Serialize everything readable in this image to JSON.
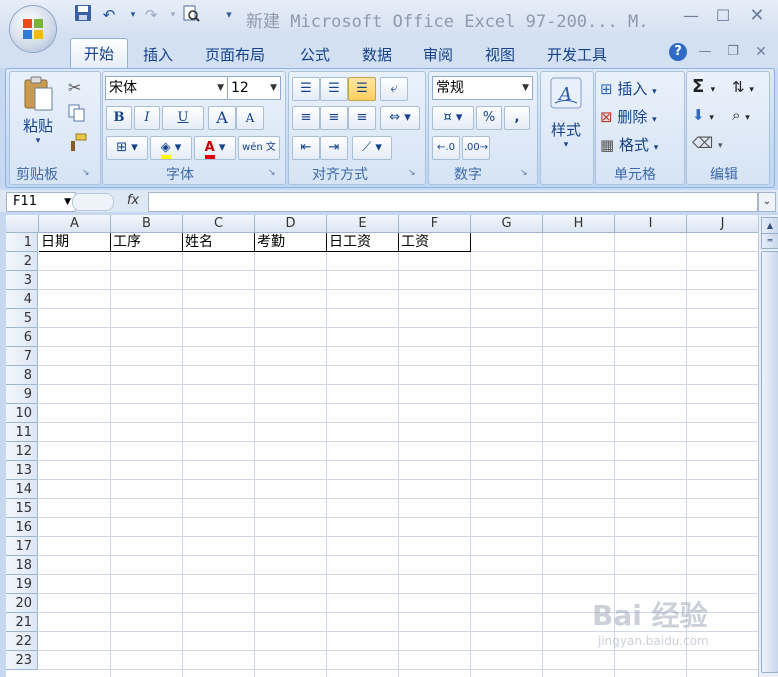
{
  "title": "新建 Microsoft Office Excel 97-200... M.",
  "tabs": [
    {
      "label": "开始"
    },
    {
      "label": "插入"
    },
    {
      "label": "页面布局"
    },
    {
      "label": "公式"
    },
    {
      "label": "数据"
    },
    {
      "label": "审阅"
    },
    {
      "label": "视图"
    },
    {
      "label": "开发工具"
    }
  ],
  "ribbon": {
    "clipboard": {
      "paste_label": "粘贴",
      "group_label": "剪贴板"
    },
    "font": {
      "font_name": "宋体",
      "font_size": "12",
      "group_label": "字体",
      "bold": "B",
      "italic": "I",
      "underline": "U",
      "grow": "A",
      "shrink": "A",
      "wen": "wén 文",
      "font_color_icon": "A"
    },
    "alignment": {
      "group_label": "对齐方式"
    },
    "number": {
      "format": "常规",
      "percent": "%",
      "comma": ",",
      "group_label": "数字"
    },
    "styles": {
      "label": "样式"
    },
    "cells": {
      "insert": "插入",
      "delete": "删除",
      "format": "格式",
      "group_label": "单元格"
    },
    "editing": {
      "sigma": "Σ",
      "group_label": "编辑"
    }
  },
  "formula_bar": {
    "name_box": "F11",
    "fx": "fx",
    "value": ""
  },
  "columns": [
    "A",
    "B",
    "C",
    "D",
    "E",
    "F",
    "G",
    "H",
    "I",
    "J"
  ],
  "rows": [
    "1",
    "2",
    "3",
    "4",
    "5",
    "6",
    "7",
    "8",
    "9",
    "10",
    "11",
    "12",
    "13",
    "14",
    "15",
    "16",
    "17",
    "18",
    "19",
    "20",
    "21",
    "22",
    "23"
  ],
  "row1": [
    "日期",
    "工序",
    "姓名",
    "考勤",
    "日工资",
    "工资"
  ],
  "watermark": {
    "brand": "Bai 经验",
    "url": "jingyan.baidu.com"
  },
  "colors": {
    "ribbon_bg": "#c6d9f1",
    "tab_text": "#15428b",
    "grid_line": "#d0d7e5"
  }
}
